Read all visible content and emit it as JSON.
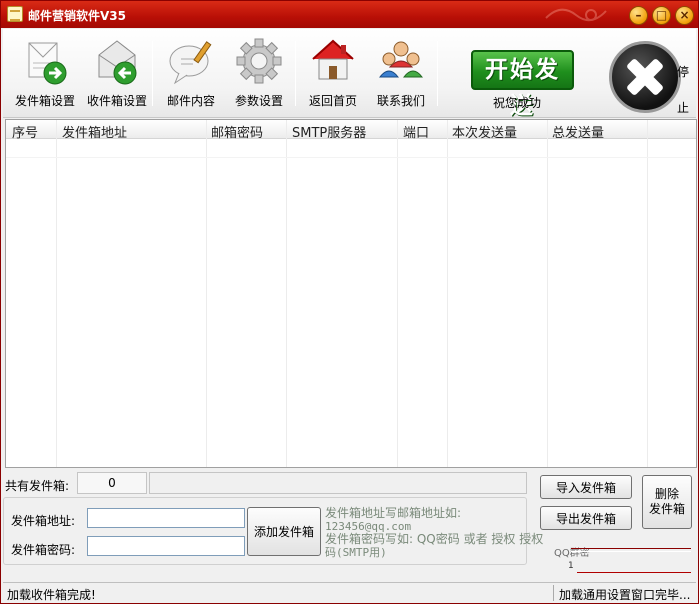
{
  "window": {
    "title": "邮件营销软件V35",
    "buttons": [
      "minimize",
      "maximize",
      "close"
    ]
  },
  "toolbar": {
    "items": [
      {
        "label": "发件箱设置",
        "icon": "outbox-settings-icon"
      },
      {
        "label": "收件箱设置",
        "icon": "inbox-settings-icon"
      },
      {
        "label": "邮件内容",
        "icon": "mail-content-icon"
      },
      {
        "label": "参数设置",
        "icon": "gear-icon"
      },
      {
        "label": "返回首页",
        "icon": "home-icon"
      },
      {
        "label": "联系我们",
        "icon": "contact-people-icon"
      }
    ],
    "start_label": "开始发送",
    "wish_text": "祝您成功",
    "stop_label": "停止"
  },
  "table": {
    "columns": [
      "序号",
      "发件箱地址",
      "邮箱密码",
      "SMTP服务器",
      "端口",
      "本次发送量",
      "总发送量"
    ],
    "rows": []
  },
  "summary": {
    "count_label": "共有发件箱:",
    "count_value": "0"
  },
  "form": {
    "address_label": "发件箱地址:",
    "address_value": "",
    "password_label": "发件箱密码:",
    "password_value": "",
    "add_button": "添加发件箱",
    "hint_line1": "发件箱地址写邮箱地址如:",
    "hint_line2": "123456@qq.com",
    "hint_line3": "发件箱密码写如: QQ密码 或者 授权 授权",
    "hint_line4": "码(SMTP用)"
  },
  "side_buttons": {
    "import": "导入发件箱",
    "export": "导出发件箱",
    "delete_line1": "删除",
    "delete_line2": "发件箱"
  },
  "qq_area": {
    "label": "QQ群密",
    "small": "1"
  },
  "status": {
    "left": "加载收件箱完成!",
    "right": "加载通用设置窗口完毕..."
  },
  "colors": {
    "titlebar": "#c0170a",
    "start_button": "#1f8f1d",
    "hint_text": "#7a8a7a"
  }
}
